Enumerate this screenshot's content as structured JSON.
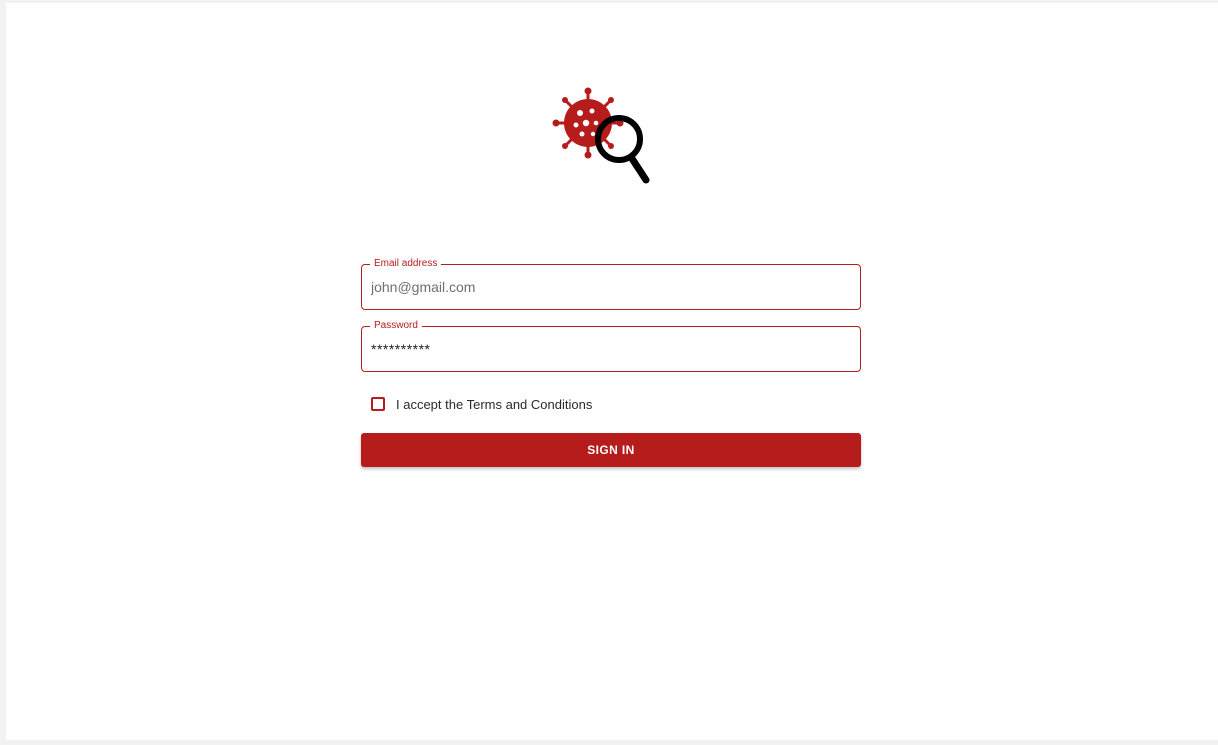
{
  "theme": {
    "accent": "#b71c1c",
    "page_background": "#ffffff"
  },
  "logo": {
    "icon": "virus-magnifier-logo-icon"
  },
  "form": {
    "email": {
      "label": "Email address",
      "value": "",
      "placeholder": "john@gmail.com"
    },
    "password": {
      "label": "Password",
      "value": "**********"
    },
    "terms": {
      "label": "I accept the Terms and Conditions",
      "checked": false
    },
    "submit_label": "SIGN IN"
  }
}
